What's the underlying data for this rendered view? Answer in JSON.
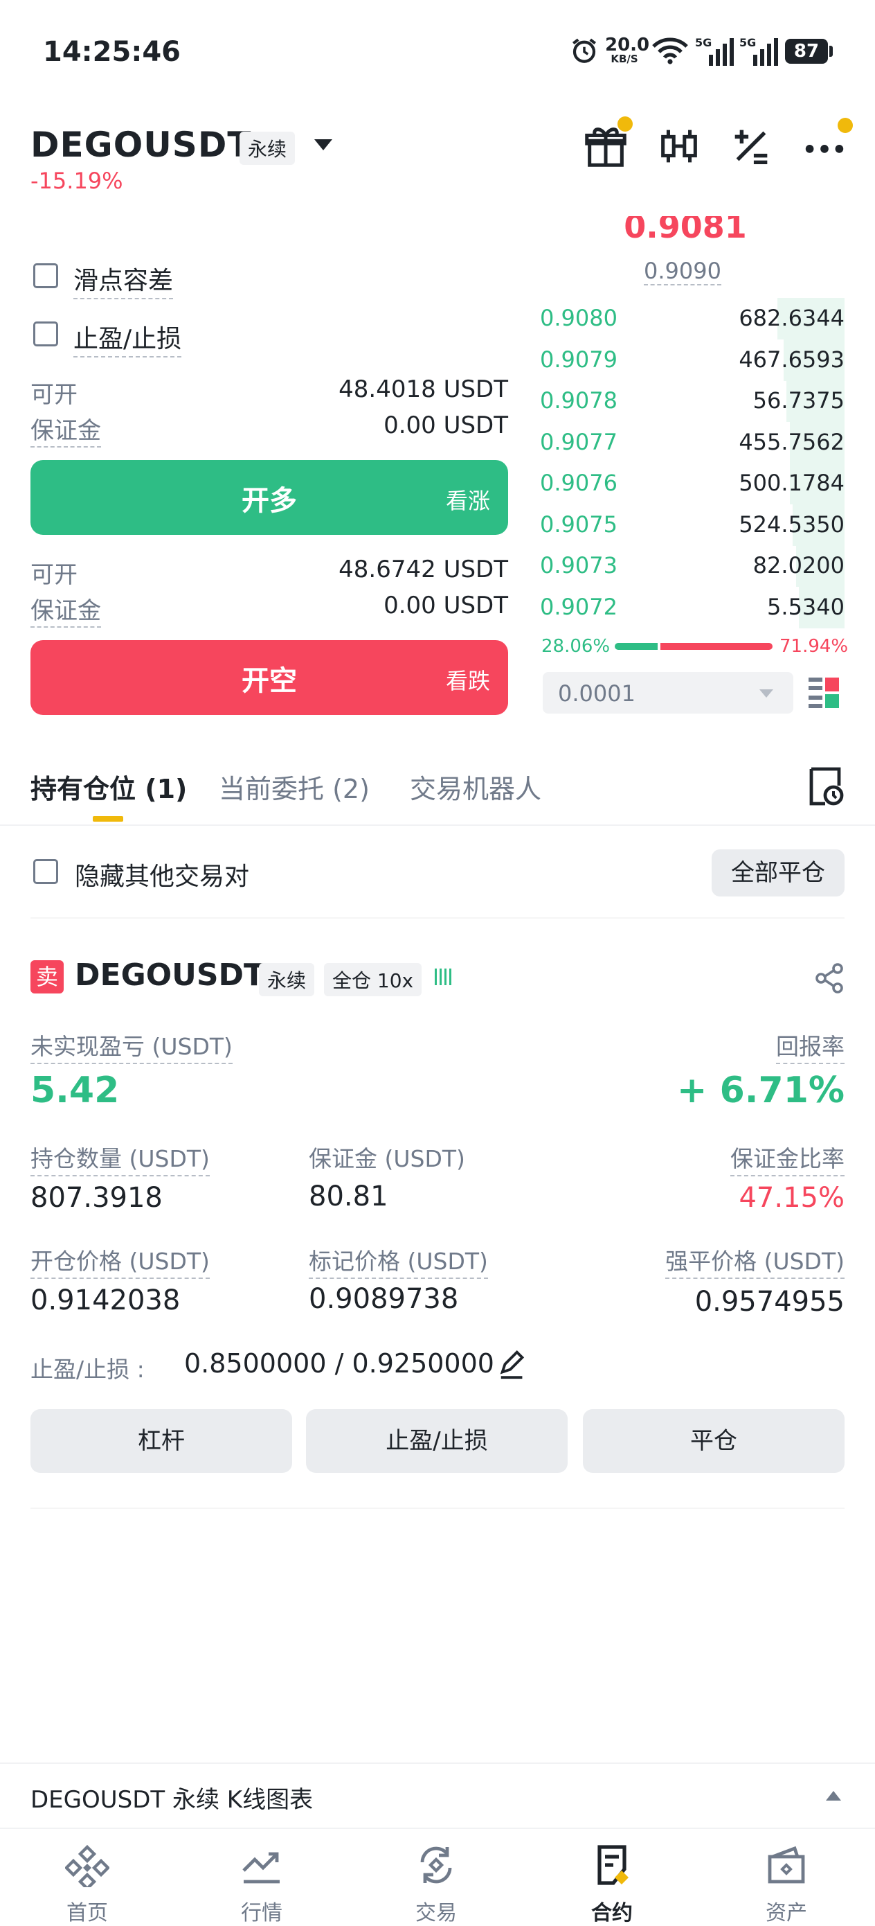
{
  "status_bar": {
    "time": "14:25:46",
    "net_speed": "20.0",
    "net_unit": "KB/S",
    "net_5g_a": "5G",
    "net_5g_b": "5G",
    "battery": "87"
  },
  "header": {
    "symbol": "DEGOUSDT",
    "contract_type": "永续",
    "change": "-15.19%"
  },
  "form": {
    "slippage_label": "滑点容差",
    "tp_sl_label": "止盈/止损",
    "long_available_label": "可开",
    "long_available_value": "48.4018 USDT",
    "long_margin_label": "保证金",
    "long_margin_value": "0.00 USDT",
    "long_button": "开多",
    "long_sub": "看涨",
    "short_available_label": "可开",
    "short_available_value": "48.6742 USDT",
    "short_margin_label": "保证金",
    "short_margin_value": "0.00 USDT",
    "short_button": "开空",
    "short_sub": "看跌"
  },
  "order_book": {
    "last_price": "0.9081",
    "mark_price": "0.9090",
    "bids": [
      {
        "price": "0.9080",
        "qty": "682.6344",
        "depth": 0.22
      },
      {
        "price": "0.9079",
        "qty": "467.6593",
        "depth": 0.2
      },
      {
        "price": "0.9078",
        "qty": "56.7375",
        "depth": 0.19
      },
      {
        "price": "0.9077",
        "qty": "455.7562",
        "depth": 0.18
      },
      {
        "price": "0.9076",
        "qty": "500.1784",
        "depth": 0.18
      },
      {
        "price": "0.9075",
        "qty": "524.5350",
        "depth": 0.17
      },
      {
        "price": "0.9073",
        "qty": "82.0200",
        "depth": 0.16
      },
      {
        "price": "0.9072",
        "qty": "5.5340",
        "depth": 0.15
      }
    ],
    "buy_ratio": "28.06%",
    "sell_ratio": "71.94%",
    "buy_ratio_value": 0.2806,
    "precision": "0.0001"
  },
  "tabs": [
    {
      "label": "持有仓位 (1)"
    },
    {
      "label": "当前委托 (2)"
    },
    {
      "label": "交易机器人"
    }
  ],
  "filter": {
    "hide_others_label": "隐藏其他交易对",
    "close_all_label": "全部平仓"
  },
  "position": {
    "side_badge": "卖",
    "symbol": "DEGOUSDT",
    "type": "永续",
    "margin_mode": "全仓 10x",
    "unrealized_label": "未实现盈亏 (USDT)",
    "unrealized_value": "5.42",
    "roe_label": "回报率",
    "roe_value": "+ 6.71%",
    "size_label": "持仓数量 (USDT)",
    "size_value": "807.3918",
    "margin_label": "保证金 (USDT)",
    "margin_value": "80.81",
    "margin_ratio_label": "保证金比率",
    "margin_ratio_value": "47.15%",
    "entry_label": "开仓价格 (USDT)",
    "entry_value": "0.9142038",
    "mark_label": "标记价格 (USDT)",
    "mark_value": "0.9089738",
    "liq_label": "强平价格 (USDT)",
    "liq_value": "0.9574955",
    "tpsl_label": "止盈/止损 :",
    "tpsl_value": "0.8500000 / 0.9250000",
    "btn_leverage": "杠杆",
    "btn_tpsl": "止盈/止损",
    "btn_close": "平仓"
  },
  "kline_bar": {
    "label": "DEGOUSDT 永续 K线图表"
  },
  "bottom_nav": [
    {
      "label": "首页",
      "icon": "home-icon"
    },
    {
      "label": "行情",
      "icon": "markets-icon"
    },
    {
      "label": "交易",
      "icon": "trade-icon"
    },
    {
      "label": "合约",
      "icon": "futures-icon"
    },
    {
      "label": "资产",
      "icon": "wallet-icon"
    }
  ],
  "colors": {
    "green": "#2ebd85",
    "red": "#f6465d",
    "yellow": "#f0b90b"
  }
}
